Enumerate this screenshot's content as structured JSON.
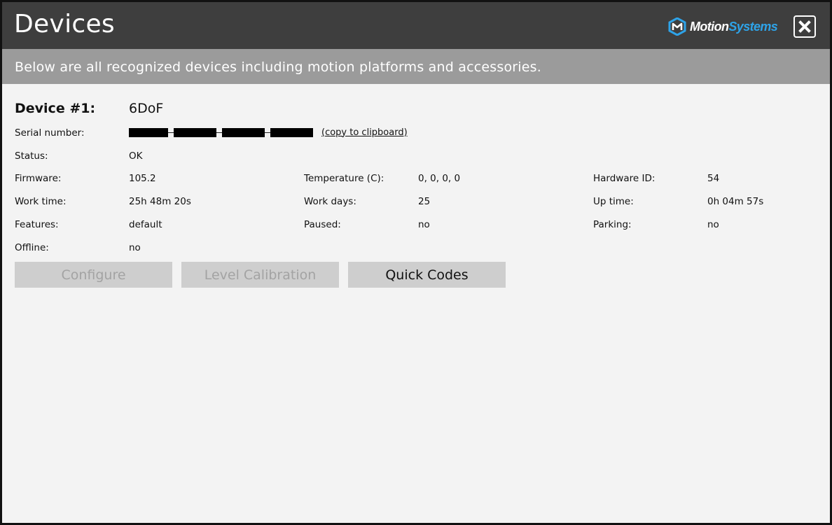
{
  "window": {
    "title": "Devices",
    "brand": {
      "part1": "Motion",
      "part2": "Systems"
    },
    "close_icon": "close-icon",
    "colors": {
      "titlebar": "#3e3e3e",
      "subheader": "#9b9b9b",
      "content": "#f3f3f3",
      "brand_accent": "#2ea3e8"
    }
  },
  "subheader": {
    "text": "Below are all recognized devices including motion platforms and accessories."
  },
  "device": {
    "label": "Device #1:",
    "name": "6DoF",
    "serial": {
      "label": "Serial number:",
      "copy_link": "(copy to clipboard)"
    },
    "status": {
      "label": "Status:",
      "value": "OK"
    },
    "firmware": {
      "label": "Firmware:",
      "value": "105.2"
    },
    "temperature": {
      "label": "Temperature (C):",
      "value": "0, 0, 0, 0"
    },
    "hardware_id": {
      "label": "Hardware ID:",
      "value": "54"
    },
    "work_time": {
      "label": "Work time:",
      "value": "25h 48m 20s"
    },
    "work_days": {
      "label": "Work days:",
      "value": "25"
    },
    "up_time": {
      "label": "Up time:",
      "value": "0h 04m 57s"
    },
    "features": {
      "label": "Features:",
      "value": "default"
    },
    "paused": {
      "label": "Paused:",
      "value": "no"
    },
    "parking": {
      "label": "Parking:",
      "value": "no"
    },
    "offline": {
      "label": "Offline:",
      "value": "no"
    }
  },
  "buttons": {
    "configure": "Configure",
    "level_calibration": "Level Calibration",
    "quick_codes": "Quick Codes"
  }
}
